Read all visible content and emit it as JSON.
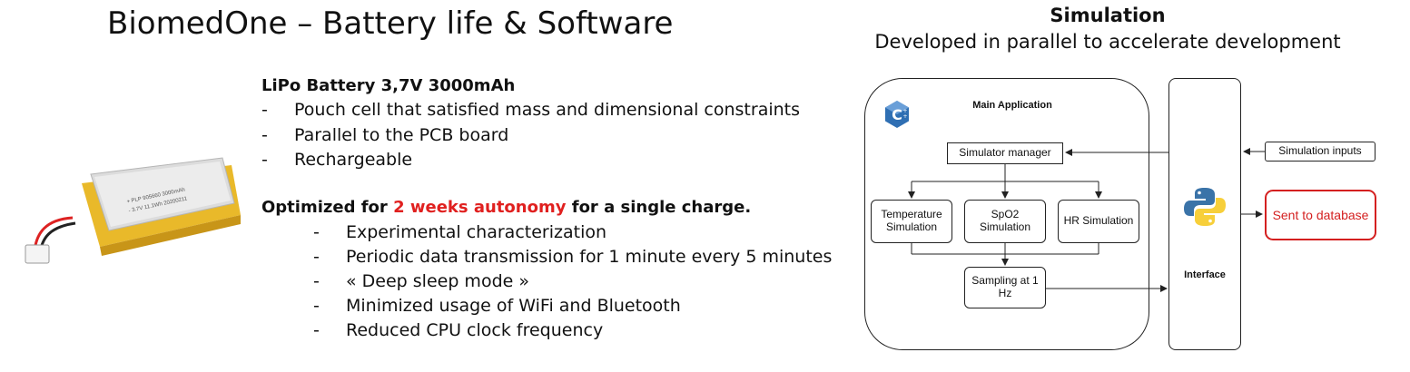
{
  "slide": {
    "title": "BiomedOne – Battery life & Software"
  },
  "battery": {
    "heading": "LiPo Battery 3,7V 3000mAh",
    "bullets": [
      "Pouch cell that satisfied mass and dimensional constraints",
      "Parallel to the PCB board",
      "Rechargeable"
    ],
    "cell_print_1": "+ PLP 905660 3000mAh",
    "cell_print_2": "- 3.7V 11.1Wh 20200211"
  },
  "autonomy": {
    "prefix": "Optimized for ",
    "highlight": "2 weeks autonomy",
    "suffix": " for a single charge.",
    "bullets": [
      "Experimental characterization",
      "Periodic data transmission for 1 minute every 5 minutes",
      "« Deep sleep mode »",
      "Minimized usage of WiFi and Bluetooth",
      "Reduced CPU clock frequency"
    ],
    "dash": "-"
  },
  "simulation": {
    "title": "Simulation",
    "subtitle": "Developed in parallel to accelerate development",
    "main_app_label": "Main Application",
    "cpp_logo_letter": "C",
    "simulator_manager": "Simulator manager",
    "temperature": "Temperature Simulation",
    "spo2": "SpO2 Simulation",
    "hr": "HR Simulation",
    "sampling": "Sampling at 1 Hz",
    "interface_label": "Interface",
    "inputs": "Simulation inputs",
    "database": "Sent to database"
  },
  "colors": {
    "accent_red": "#e0201f",
    "cpp_blue": "#2f6fb3",
    "python_blue": "#3a73a8",
    "python_yellow": "#f7cf3a"
  }
}
